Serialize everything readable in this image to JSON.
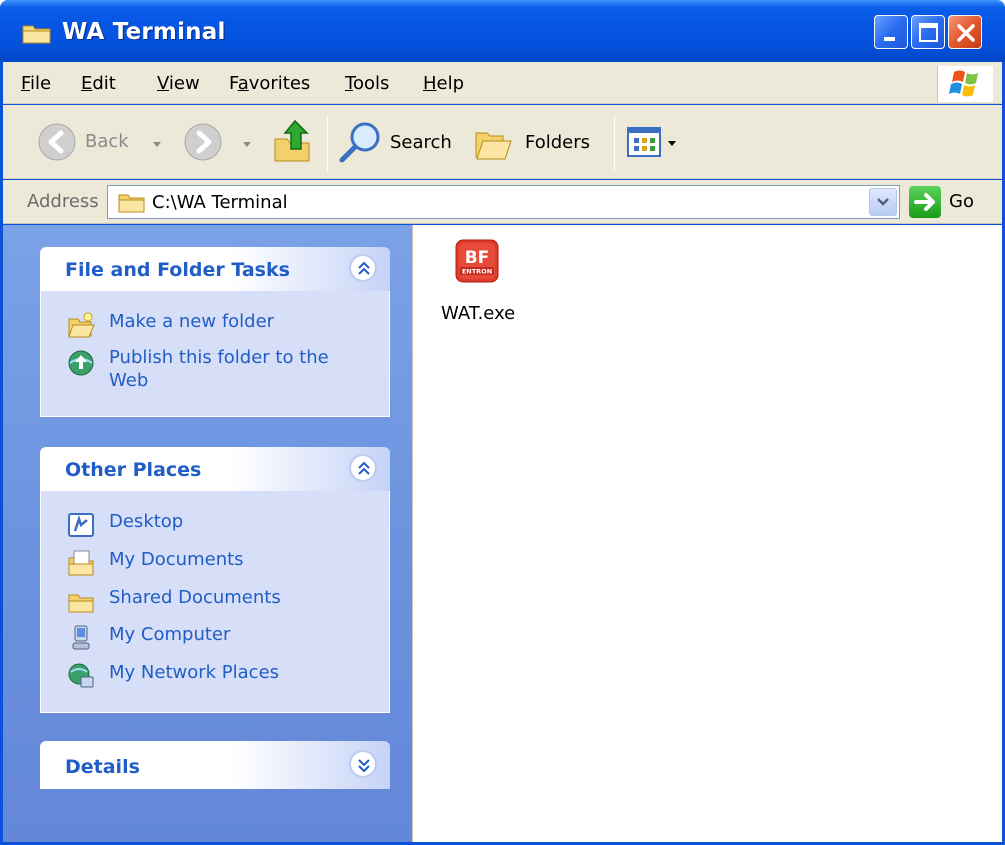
{
  "window": {
    "title": "WA Terminal",
    "colors": {
      "titlebar": "#0655e4",
      "close": "#e3582f",
      "leftpane": "#6c93df",
      "link": "#215dc6"
    }
  },
  "menu": {
    "items": [
      {
        "label": "File",
        "accel": "F",
        "rest": "ile"
      },
      {
        "label": "Edit",
        "accel": "E",
        "rest": "dit"
      },
      {
        "label": "View",
        "accel": "V",
        "rest": "iew"
      },
      {
        "label": "Favorites",
        "pre": "F",
        "accel": "a",
        "rest": "vorites"
      },
      {
        "label": "Tools",
        "accel": "T",
        "rest": "ools"
      },
      {
        "label": "Help",
        "accel": "H",
        "rest": "elp"
      }
    ]
  },
  "toolbar": {
    "back_label": "Back",
    "search_label": "Search",
    "folders_label": "Folders"
  },
  "address": {
    "label": "Address",
    "value": "C:\\WA Terminal",
    "go_label": "Go"
  },
  "tasks_panel": {
    "title": "File and Folder Tasks",
    "items": [
      {
        "label": "Make a new folder",
        "icon": "new-folder-icon"
      },
      {
        "label_line1": "Publish this folder to the",
        "label_line2": "Web",
        "icon": "publish-web-icon"
      }
    ]
  },
  "places_panel": {
    "title": "Other Places",
    "items": [
      {
        "label": "Desktop",
        "icon": "desktop-icon"
      },
      {
        "label": "My Documents",
        "icon": "my-documents-icon"
      },
      {
        "label": "Shared Documents",
        "icon": "shared-documents-icon"
      },
      {
        "label": "My Computer",
        "icon": "my-computer-icon"
      },
      {
        "label": "My Network Places",
        "icon": "network-places-icon"
      }
    ]
  },
  "details_panel": {
    "title": "Details"
  },
  "files": [
    {
      "name": "WAT.exe",
      "logo_text": "BF",
      "logo_subtext": "ENTRON"
    }
  ]
}
